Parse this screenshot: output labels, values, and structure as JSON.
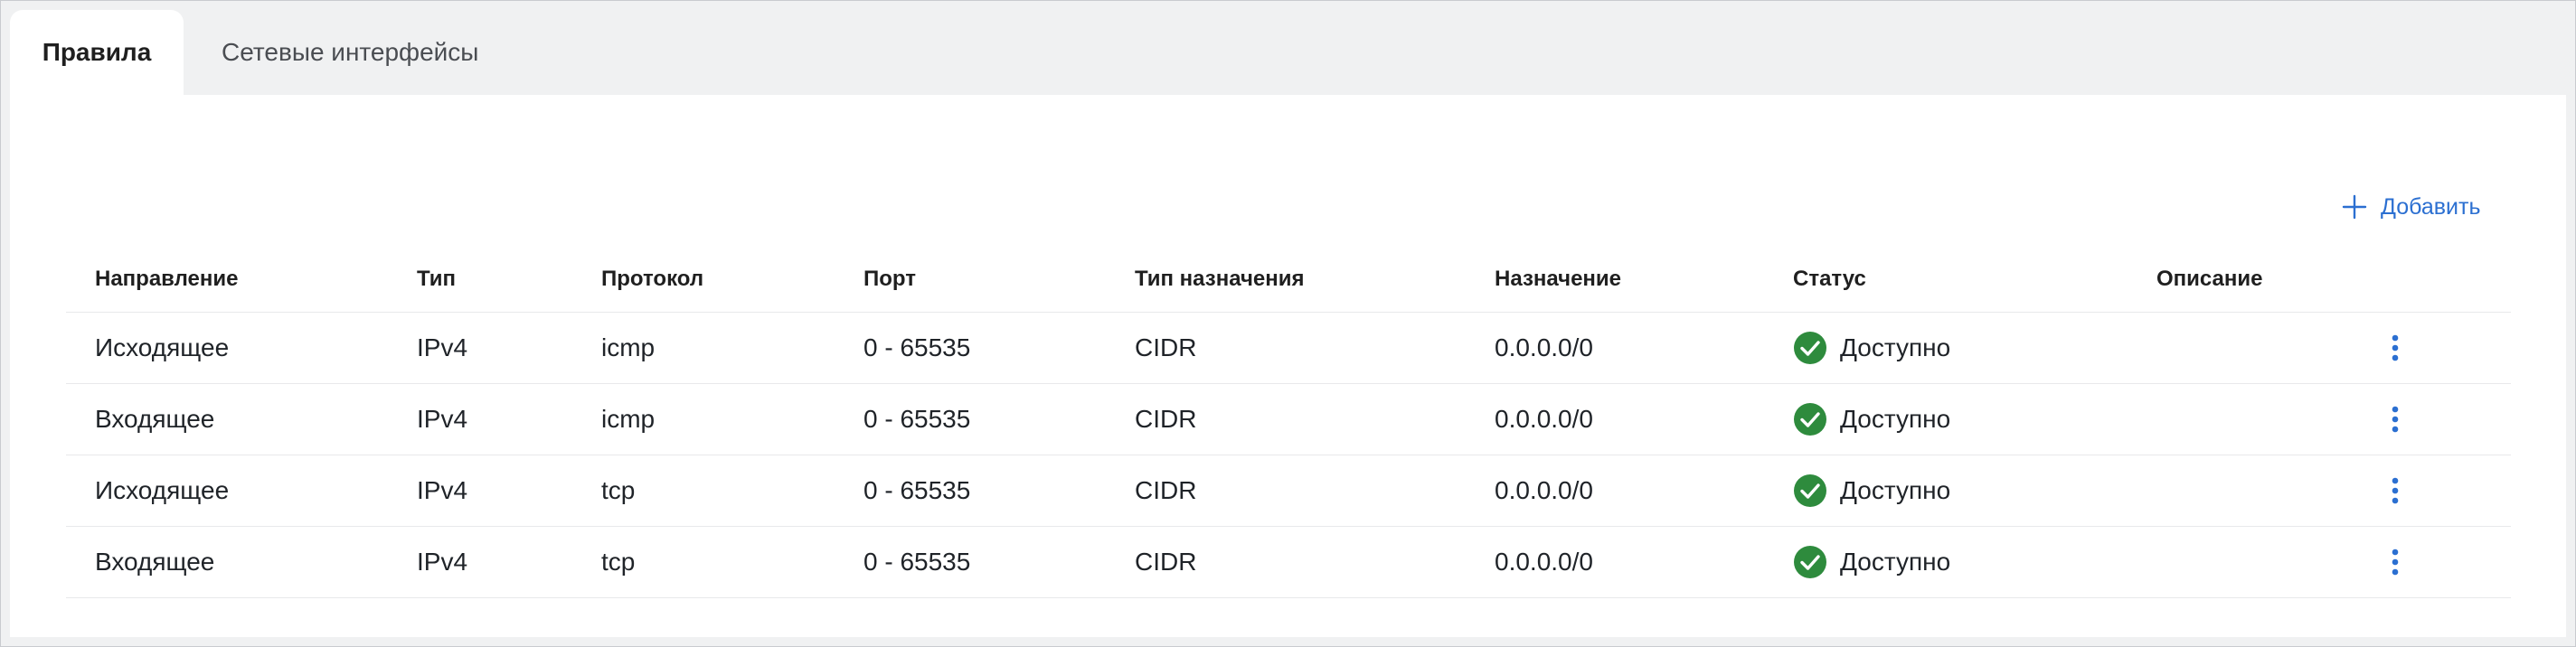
{
  "tabs": [
    {
      "label": "Правила",
      "active": true
    },
    {
      "label": "Сетевые интерфейсы",
      "active": false
    }
  ],
  "toolbar": {
    "add_label": "Добавить",
    "add_icon": "plus-icon"
  },
  "table": {
    "columns": [
      "Направление",
      "Тип",
      "Протокол",
      "Порт",
      "Тип назначения",
      "Назначение",
      "Статус",
      "Описание"
    ],
    "rows": [
      {
        "direction": "Исходящее",
        "type": "IPv4",
        "protocol": "icmp",
        "port": "0 - 65535",
        "dest_type": "CIDR",
        "destination": "0.0.0.0/0",
        "status": "Доступно",
        "description": ""
      },
      {
        "direction": "Входящее",
        "type": "IPv4",
        "protocol": "icmp",
        "port": "0 - 65535",
        "dest_type": "CIDR",
        "destination": "0.0.0.0/0",
        "status": "Доступно",
        "description": ""
      },
      {
        "direction": "Исходящее",
        "type": "IPv4",
        "protocol": "tcp",
        "port": "0 - 65535",
        "dest_type": "CIDR",
        "destination": "0.0.0.0/0",
        "status": "Доступно",
        "description": ""
      },
      {
        "direction": "Входящее",
        "type": "IPv4",
        "protocol": "tcp",
        "port": "0 - 65535",
        "dest_type": "CIDR",
        "destination": "0.0.0.0/0",
        "status": "Доступно",
        "description": ""
      }
    ]
  },
  "colors": {
    "accent": "#2b6fd1",
    "status_ok": "#2e8b3d",
    "tab_bar_bg": "#f0f1f2"
  },
  "icons": {
    "status": "check-circle-icon",
    "row_menu": "more-vertical-icon"
  }
}
